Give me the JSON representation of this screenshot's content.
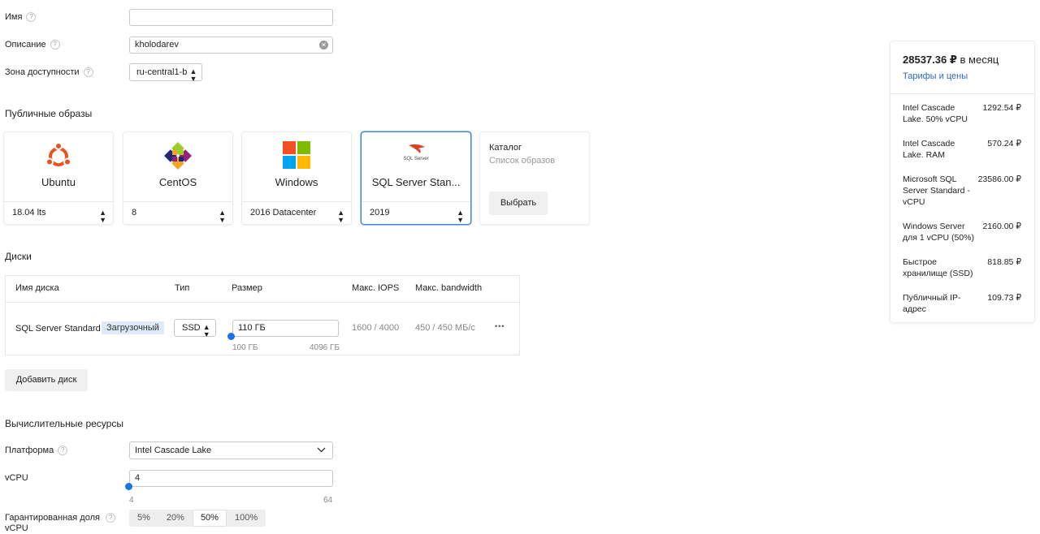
{
  "form": {
    "name_label": "Имя",
    "name_value": "",
    "description_label": "Описание",
    "description_value": "kholodarev",
    "zone_label": "Зона доступности",
    "zone_value": "ru-central1-b",
    "help_glyph": "?"
  },
  "images": {
    "title": "Публичные образы",
    "cards": [
      {
        "name": "Ubuntu",
        "version": "18.04 lts",
        "icon": "ubuntu-logo-icon"
      },
      {
        "name": "CentOS",
        "version": "8",
        "icon": "centos-logo-icon"
      },
      {
        "name": "Windows",
        "version": "2016 Datacenter",
        "icon": "windows-logo-icon"
      },
      {
        "name": "SQL Server Stan...",
        "version": "2019",
        "icon": "sql-server-logo-icon",
        "selected": true,
        "logo_text": "SQL Server"
      }
    ],
    "catalog": {
      "title": "Каталог",
      "subtitle": "Список образов",
      "button": "Выбрать"
    }
  },
  "disks": {
    "title": "Диски",
    "columns": [
      "Имя диска",
      "Тип",
      "Размер",
      "Макс. IOPS",
      "Макс. bandwidth"
    ],
    "rows": [
      {
        "name": "SQL Server Standard",
        "badge": "Загрузочный",
        "type": "SSD",
        "size": "110 ГБ",
        "size_min": "100 ГБ",
        "size_max": "4096 ГБ",
        "iops": "1600 / 4000",
        "bandwidth": "450 / 450 МБ/с",
        "menu": "•••"
      }
    ],
    "add_button": "Добавить диск"
  },
  "compute": {
    "title": "Вычислительные ресурсы",
    "platform_label": "Платформа",
    "platform_value": "Intel Cascade Lake",
    "vcpu_label": "vCPU",
    "vcpu_value": "4",
    "vcpu_min": "4",
    "vcpu_max": "64",
    "share_label": "Гарантированная доля vCPU",
    "share_options": [
      "5%",
      "20%",
      "50%",
      "100%"
    ],
    "share_selected": "50%"
  },
  "price": {
    "total": "28537.36 ₽",
    "period": "в месяц",
    "link": "Тарифы и цены",
    "items": [
      {
        "name": "Intel Cascade Lake. 50% vCPU",
        "value": "1292.54 ₽"
      },
      {
        "name": "Intel Cascade Lake. RAM",
        "value": "570.24 ₽"
      },
      {
        "name": "Microsoft SQL Server Standard - vCPU",
        "value": "23586.00 ₽"
      },
      {
        "name": "Windows Server для 1 vCPU (50%)",
        "value": "2160.00 ₽"
      },
      {
        "name": "Быстрое хранилище (SSD)",
        "value": "818.85 ₽"
      },
      {
        "name": "Публичный IP-адрес",
        "value": "109.73 ₽"
      }
    ]
  },
  "colors": {
    "accent": "#1a73e8",
    "link": "#2c6bc7",
    "selected_border": "#3a86d8",
    "badge_bg": "#dfeaf8",
    "ubuntu_orange": "#e95420",
    "windows_red": "#f25022",
    "windows_green": "#7fba00",
    "windows_blue": "#00a4ef",
    "windows_yellow": "#ffb900"
  }
}
